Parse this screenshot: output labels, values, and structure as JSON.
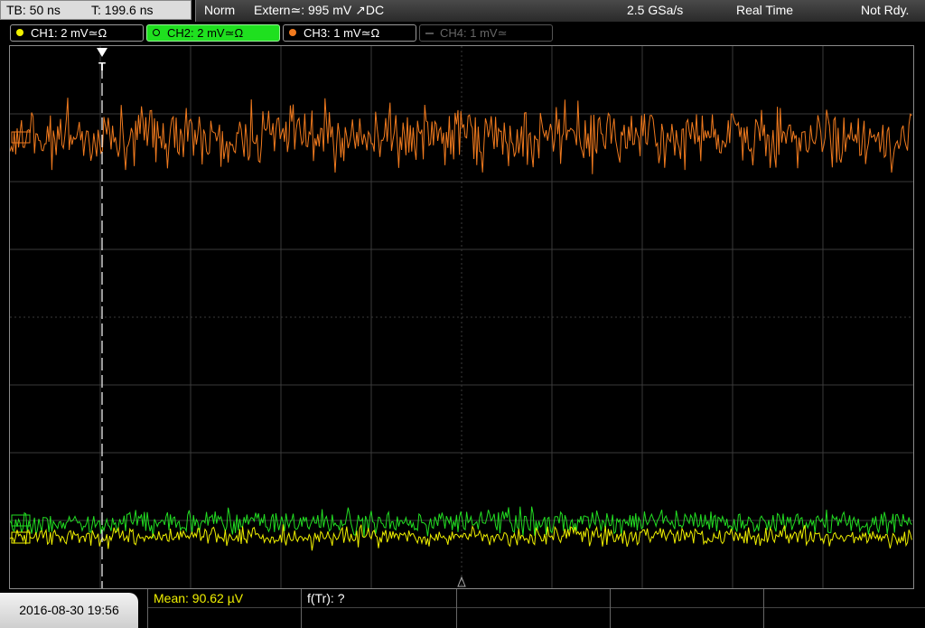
{
  "timebase": {
    "tb_label": "TB: 50 ns",
    "trigger_time_label": "T: 199.6 ns"
  },
  "status": {
    "mode": "Norm",
    "trigger_source": "Extern≃: 995 mV ↗DC",
    "sample_rate": "2.5 GSa/s",
    "acquisition": "Real Time",
    "state": "Not Rdy."
  },
  "channels": [
    {
      "label": "CH1: 2 mV≃Ω",
      "color": "#f0f000",
      "state": "on"
    },
    {
      "label": "CH2: 2 mV≃Ω",
      "color": "#1fe01f",
      "state": "active"
    },
    {
      "label": "CH3: 1 mV≃Ω",
      "color": "#f07a1e",
      "state": "on"
    },
    {
      "label": "CH4: 1 mV≃",
      "color": "#666666",
      "state": "off"
    }
  ],
  "trigger_marker": "T",
  "datetime": "2016-08-30 19:56",
  "measurements": {
    "mean_label": "Mean: 90.62 µV",
    "freq_label": "f(Tr): ?"
  },
  "colors": {
    "ch1": "#f0f000",
    "ch2": "#22dd22",
    "ch3": "#f07a1e",
    "grid": "#3a3a3a",
    "mean_text": "#f0f000"
  }
}
